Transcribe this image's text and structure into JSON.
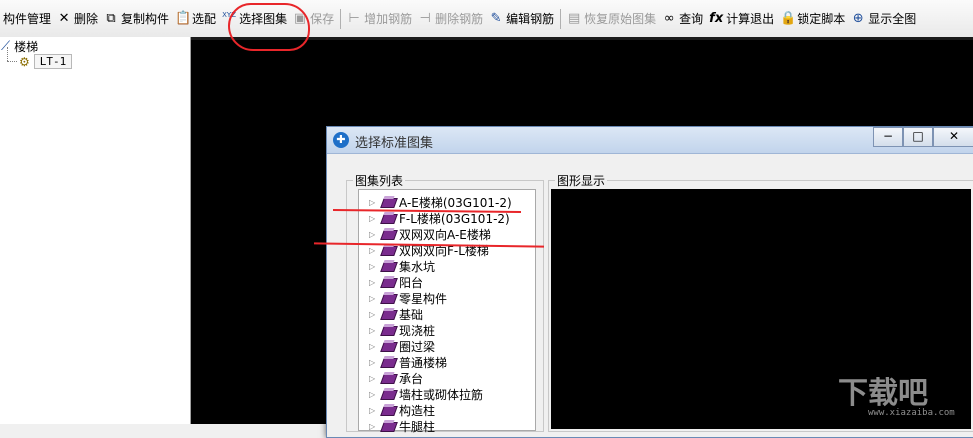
{
  "toolbar": {
    "items": [
      {
        "label": "构件管理",
        "icon": "none",
        "enabled": true
      },
      {
        "label": "删除",
        "icon": "delete-x-icon",
        "enabled": true
      },
      {
        "label": "复制构件",
        "icon": "copy-icon",
        "enabled": true
      },
      {
        "label": "选配",
        "icon": "clipboard-icon",
        "enabled": true
      },
      {
        "label": "选择图集",
        "icon": "xyz-icon",
        "enabled": true
      },
      {
        "label": "保存",
        "icon": "save-icon",
        "enabled": false
      },
      {
        "label": "增加钢筋",
        "icon": "add-rebar-icon",
        "enabled": false
      },
      {
        "label": "删除钢筋",
        "icon": "delete-rebar-icon",
        "enabled": false
      },
      {
        "label": "编辑钢筋",
        "icon": "edit-rebar-icon",
        "enabled": true
      },
      {
        "label": "恢复原始图集",
        "icon": "restore-icon",
        "enabled": false
      },
      {
        "label": "查询",
        "icon": "binoculars-icon",
        "enabled": true
      },
      {
        "label": "计算退出",
        "icon": "fx-icon",
        "enabled": true
      },
      {
        "label": "锁定脚本",
        "icon": "lock-icon",
        "enabled": true
      },
      {
        "label": "显示全图",
        "icon": "zoom-icon",
        "enabled": true
      }
    ]
  },
  "tree": {
    "root_label": "楼梯",
    "child_label": "LT-1"
  },
  "dialog": {
    "title": "选择标准图集",
    "minimize": "−",
    "maximize": "□",
    "close": "✕",
    "list_group_label": "图集列表",
    "preview_group_label": "图形显示",
    "items": [
      "A-E楼梯(03G101-2)",
      "F-L楼梯(03G101-2)",
      "双网双向A-E楼梯",
      "双网双向F-L楼梯",
      "集水坑",
      "阳台",
      "零星构件",
      "基础",
      "现浇桩",
      "圈过梁",
      "普通楼梯",
      "承台",
      "墙柱或砌体拉筋",
      "构造柱",
      "牛腿柱"
    ]
  },
  "watermark": {
    "text": "下载吧",
    "url": "www.xiazaiba.com"
  },
  "colors": {
    "annotation_red": "#e8262a",
    "book_purple": "#7a2c8e"
  }
}
